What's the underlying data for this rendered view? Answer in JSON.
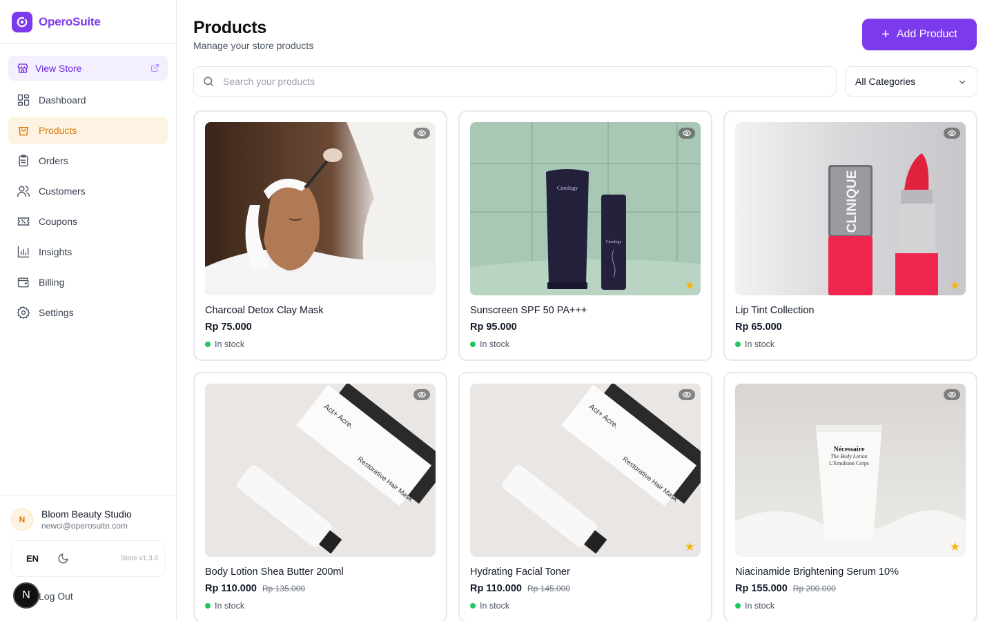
{
  "brand": {
    "name": "OperoSuite",
    "accent": "#7c3aed"
  },
  "sidebar": {
    "view_store": "View Store",
    "items": [
      {
        "label": "Dashboard",
        "icon": "dashboard-icon",
        "active": false
      },
      {
        "label": "Products",
        "icon": "shopping-bag-icon",
        "active": true
      },
      {
        "label": "Orders",
        "icon": "clipboard-icon",
        "active": false
      },
      {
        "label": "Customers",
        "icon": "users-icon",
        "active": false
      },
      {
        "label": "Coupons",
        "icon": "ticket-icon",
        "active": false
      },
      {
        "label": "Insights",
        "icon": "bar-chart-icon",
        "active": false
      },
      {
        "label": "Billing",
        "icon": "wallet-icon",
        "active": false
      },
      {
        "label": "Settings",
        "icon": "gear-icon",
        "active": false
      }
    ],
    "user": {
      "initial": "N",
      "name": "Bloom Beauty Studio",
      "email": "newci@operosuite.com"
    },
    "lang": "EN",
    "version": "Store v1.3.0",
    "logout": "Log Out",
    "next_badge": "N"
  },
  "header": {
    "title": "Products",
    "subtitle": "Manage your store products",
    "add_button": "Add Product"
  },
  "filters": {
    "search_placeholder": "Search your products",
    "search_value": "",
    "category": "All Categories"
  },
  "products": [
    {
      "name": "Charcoal Detox Clay Mask",
      "price": "Rp 75.000",
      "original_price": "",
      "stock": "In stock",
      "featured": false,
      "image": "clay-mask"
    },
    {
      "name": "Sunscreen SPF 50 PA+++",
      "price": "Rp 95.000",
      "original_price": "",
      "stock": "In stock",
      "featured": true,
      "image": "sunscreen"
    },
    {
      "name": "Lip Tint Collection",
      "price": "Rp 65.000",
      "original_price": "",
      "stock": "In stock",
      "featured": true,
      "image": "lip-tint"
    },
    {
      "name": "Body Lotion Shea Butter 200ml",
      "price": "Rp 110.000",
      "original_price": "Rp 135.000",
      "stock": "In stock",
      "featured": false,
      "image": "hair-mask"
    },
    {
      "name": "Hydrating Facial Toner",
      "price": "Rp 110.000",
      "original_price": "Rp 145.000",
      "stock": "In stock",
      "featured": true,
      "image": "hair-mask"
    },
    {
      "name": "Niacinamide Brightening Serum 10%",
      "price": "Rp 155.000",
      "original_price": "Rp 200.000",
      "stock": "In stock",
      "featured": true,
      "image": "serum-tube"
    }
  ],
  "image_text": {
    "curology": "Curology",
    "clinique": "CLINIQUE",
    "act_acre": "Act+ Acre.",
    "hair_mask": "Restorative Hair Mask",
    "necessaire": "Nécessaire",
    "body_lotion": "The Body Lotion",
    "emulsion": "L'Emulsion Corps"
  }
}
